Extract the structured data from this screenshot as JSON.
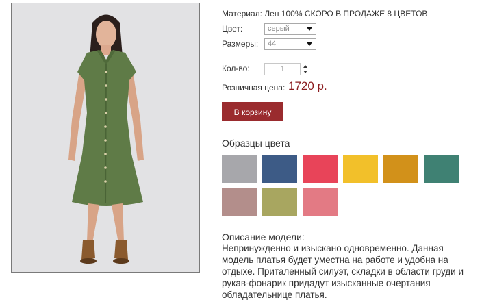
{
  "product": {
    "material": "Материал: Лен 100% СКОРО В ПРОДАЖЕ 8 ЦВЕТОВ",
    "color_label": "Цвет:",
    "color_value": "серый",
    "size_label": "Размеры:",
    "size_value": "44",
    "qty_label": "Кол-во:",
    "qty_value": "1",
    "price_label": "Розничная цена:",
    "price_value": "1720 р.",
    "cart_button": "В корзину",
    "swatch_title": "Образцы цвета",
    "swatches": [
      {
        "color": "#a7a7ab"
      },
      {
        "color": "#3d5b86"
      },
      {
        "color": "#e84459"
      },
      {
        "color": "#f2c02a"
      },
      {
        "color": "#d2911a"
      },
      {
        "color": "#3f8173"
      },
      {
        "color": "#b38e8b"
      },
      {
        "color": "#a8a660"
      },
      {
        "color": "#e37a84"
      }
    ],
    "description_title": "Описание модели:",
    "description_lines": [
      "Непринужденно и изыскано одновременно. Данная",
      "модель платья будет уместна на работе и удобна на",
      "отдыхе. Приталенный силуэт, складки в области груди и",
      "рукав-фонарик придадут изысканные очертания",
      "обладательнице платья."
    ]
  },
  "colors": {
    "price": "#8b1c1f",
    "button": "#9a2b2e",
    "dress": "#5f7b47",
    "photo_bg": "#e2e2e4"
  }
}
